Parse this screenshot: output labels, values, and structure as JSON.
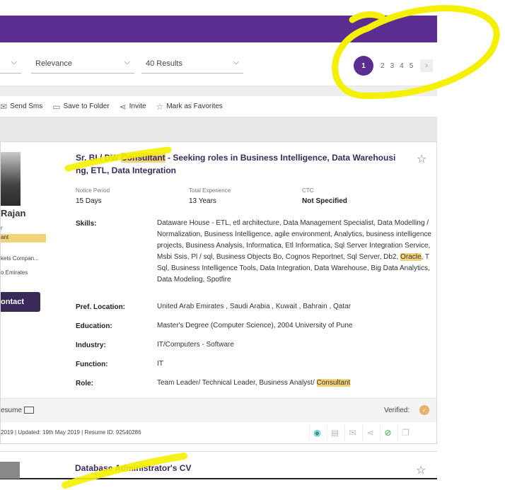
{
  "filters": {
    "sort": "Relevance",
    "results": "40 Results"
  },
  "pagination": {
    "current": "1",
    "pages": [
      "2",
      "3",
      "4",
      "5"
    ],
    "next_glyph": "›"
  },
  "actions": [
    {
      "label": "Send Sms",
      "icon": "sms-icon",
      "glyph": "✉"
    },
    {
      "label": "Save to Folder",
      "icon": "folder-icon",
      "glyph": "▭"
    },
    {
      "label": "Invite",
      "icon": "share-icon",
      "glyph": "⋖"
    },
    {
      "label": "Mark as Favorites",
      "icon": "star-icon",
      "glyph": "☆"
    }
  ],
  "card1": {
    "left": {
      "name": "Rajan",
      "line1": "r",
      "line2": "ant",
      "company": "kets Compan...",
      "location": "o Emirates",
      "contact": "ontact"
    },
    "title_parts": [
      "Sr. BI / DW ",
      "Consultant",
      " - Seeking roles in Business Intelligence, Data Warehousi ng, ETL, Data Integration"
    ],
    "meta": {
      "notice_label": "Notice Period",
      "notice_value": "15 Days",
      "exp_label": "Total Experience",
      "exp_value": "13 Years",
      "ctc_label": "CTC",
      "ctc_value": "Not Specified"
    },
    "skills_label": "Skills:",
    "skills_parts": [
      "Dataware House - ETL, etl architecture, Data Management Specialist, Data Modelling / Normalization, Business Intelligence, agile environment, Analytics, business intelligence projects, Business Analysis, Informatica, Etl Informatica, Sql Server Integration Service, Msbi Ssis, Pl / sql, Business Objects Bo, Cognos Reportnet, Sql Server, Db2, ",
      "Oracle",
      ", T Sql, Business Intelligence Tools, Data Integration, Data Warehouse, Big Data Analytics, Data Modeling, Spotfire"
    ],
    "pref_label": "Pref. Location:",
    "pref_value": "United Arab Emirates , Saudi Arabia , Kuwait , Bahrain , Qatar",
    "edu_label": "Education:",
    "edu_value": "Master's Degree (Computer Science), 2004 University of Pune",
    "industry_label": "Industry:",
    "industry_value": "IT/Computers - Software",
    "function_label": "Function:",
    "function_value": "IT",
    "role_label": "Role:",
    "role_parts": [
      "Team Leader/ Technical Leader, Business Analyst/ ",
      "Consultant"
    ],
    "footer": {
      "resume": "esume",
      "verified": "Verified:",
      "meta": "2019 | Updated: 19th May 2019 | Resume ID: 92540286"
    }
  },
  "card2": {
    "title": "Database Administrator's CV"
  }
}
